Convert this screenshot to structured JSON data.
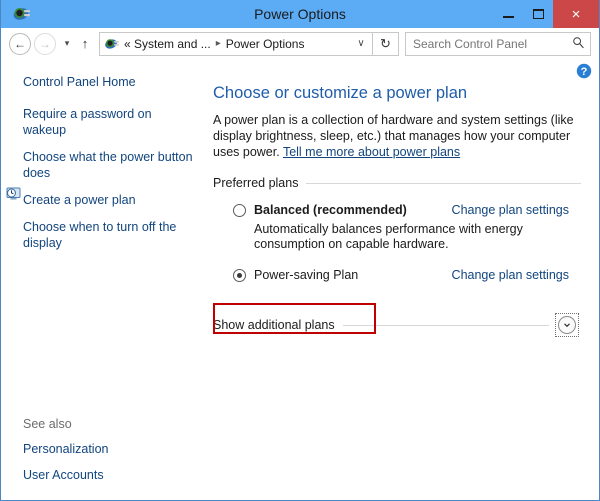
{
  "window": {
    "title": "Power Options",
    "app_icon": "power-plug-icon",
    "titlebar_color": "#5cacf5",
    "close_button_color": "#cc4848",
    "controls": {
      "minimize": "minimize-icon",
      "maximize": "maximize-icon",
      "close": "×"
    }
  },
  "navbar": {
    "back": "←",
    "forward": "→",
    "recent_pages": "▾",
    "up": "↑",
    "address_icon": "power-plug-icon",
    "breadcrumbs": [
      {
        "label": "« System and ..."
      },
      {
        "label": "Power Options"
      }
    ],
    "breadcrumb_separator": "▸",
    "address_dropdown": "∨",
    "refresh": "↻",
    "search": {
      "placeholder": "Search Control Panel",
      "value": "",
      "icon": "search-icon"
    }
  },
  "sidebar": {
    "home_label": "Control Panel Home",
    "items": [
      {
        "label": "Require a password on wakeup",
        "icon": null
      },
      {
        "label": "Choose what the power button does",
        "icon": null
      },
      {
        "label": "Create a power plan",
        "icon": null
      },
      {
        "label": "Choose when to turn off the display",
        "icon": "display-clock-icon"
      }
    ],
    "see_also": {
      "label": "See also",
      "items": [
        {
          "label": "Personalization"
        },
        {
          "label": "User Accounts"
        }
      ]
    }
  },
  "content": {
    "help_icon": "help-icon",
    "title": "Choose or customize a power plan",
    "description_part1": "A power plan is a collection of hardware and system settings (like display brightness, sleep, etc.) that manages how your computer uses power. ",
    "description_link": "Tell me more about power plans",
    "preferred_plans_label": "Preferred plans",
    "plans": [
      {
        "name": "Balanced (recommended)",
        "bold": true,
        "selected": false,
        "description": "Automatically balances performance with energy consumption on capable hardware.",
        "link_label": "Change plan settings",
        "highlighted": false
      },
      {
        "name": "Power-saving Plan",
        "bold": false,
        "selected": true,
        "description": "",
        "link_label": "Change plan settings",
        "highlighted": true
      }
    ],
    "show_additional_label": "Show additional plans",
    "expand_icon": "chevron-down-icon",
    "highlight_color": "#c00000"
  }
}
